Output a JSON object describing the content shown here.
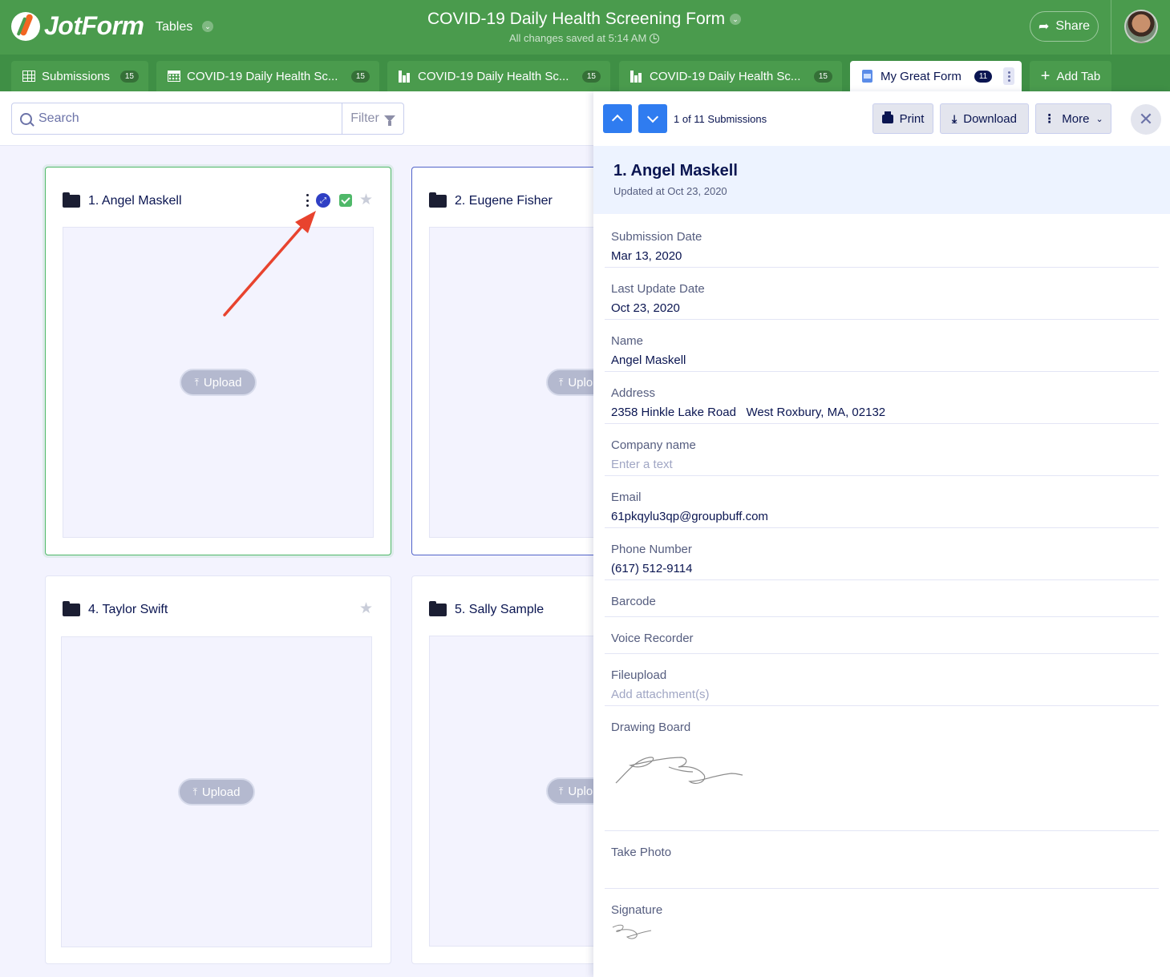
{
  "header": {
    "logo_text": "JotForm",
    "product_menu": "Tables",
    "form_title": "COVID-19 Daily Health Screening Form",
    "saved_status": "All changes saved at 5:14 AM",
    "share_label": "Share"
  },
  "tabs": [
    {
      "label": "Submissions",
      "badge": "15",
      "icon": "grid-icon"
    },
    {
      "label": "COVID-19 Daily Health Sc...",
      "badge": "15",
      "icon": "calendar-icon"
    },
    {
      "label": "COVID-19 Daily Health Sc...",
      "badge": "15",
      "icon": "report-icon"
    },
    {
      "label": "COVID-19 Daily Health Sc...",
      "badge": "15",
      "icon": "report-icon"
    },
    {
      "label": "My Great Form",
      "badge": "11",
      "icon": "form-icon",
      "active": true
    }
  ],
  "add_tab_label": "Add Tab",
  "toolbar": {
    "search_placeholder": "Search",
    "filter_label": "Filter"
  },
  "cards": [
    {
      "title": "1. Angel Maskell",
      "upload_label": "Upload"
    },
    {
      "title": "2. Eugene Fisher",
      "upload_label": "Uplo"
    },
    {
      "title": "4. Taylor Swift",
      "upload_label": "Upload"
    },
    {
      "title": "5. Sally Sample",
      "upload_label": "Uplo"
    }
  ],
  "panel": {
    "counter": "1 of 11 Submissions",
    "print_label": "Print",
    "download_label": "Download",
    "more_label": "More",
    "submission_title": "1. Angel Maskell",
    "updated_at": "Updated at Oct 23, 2020",
    "fields": [
      {
        "label": "Submission Date",
        "value": "Mar 13, 2020"
      },
      {
        "label": "Last Update Date",
        "value": "Oct 23, 2020"
      },
      {
        "label": "Name",
        "value": "Angel Maskell"
      },
      {
        "label": "Address",
        "value": "2358 Hinkle Lake Road   West Roxbury, MA, 02132"
      },
      {
        "label": "Company name",
        "value": "Enter a text"
      },
      {
        "label": "Email",
        "value": "61pkqylu3qp@groupbuff.com"
      },
      {
        "label": "Phone Number",
        "value": "(617) 512-9114"
      },
      {
        "label": "Barcode",
        "value": ""
      },
      {
        "label": "Voice Recorder",
        "value": ""
      },
      {
        "label": "Fileupload",
        "value": "Add attachment(s)"
      },
      {
        "label": "Drawing Board",
        "value": ""
      },
      {
        "label": "Take Photo",
        "value": ""
      },
      {
        "label": "Signature",
        "value": ""
      }
    ]
  },
  "colors": {
    "header_green": "#4a9b4d",
    "tabbar_green": "#3f8f45",
    "nav_blue": "#2f7cf0",
    "annotation_arrow": "#e8432e"
  }
}
